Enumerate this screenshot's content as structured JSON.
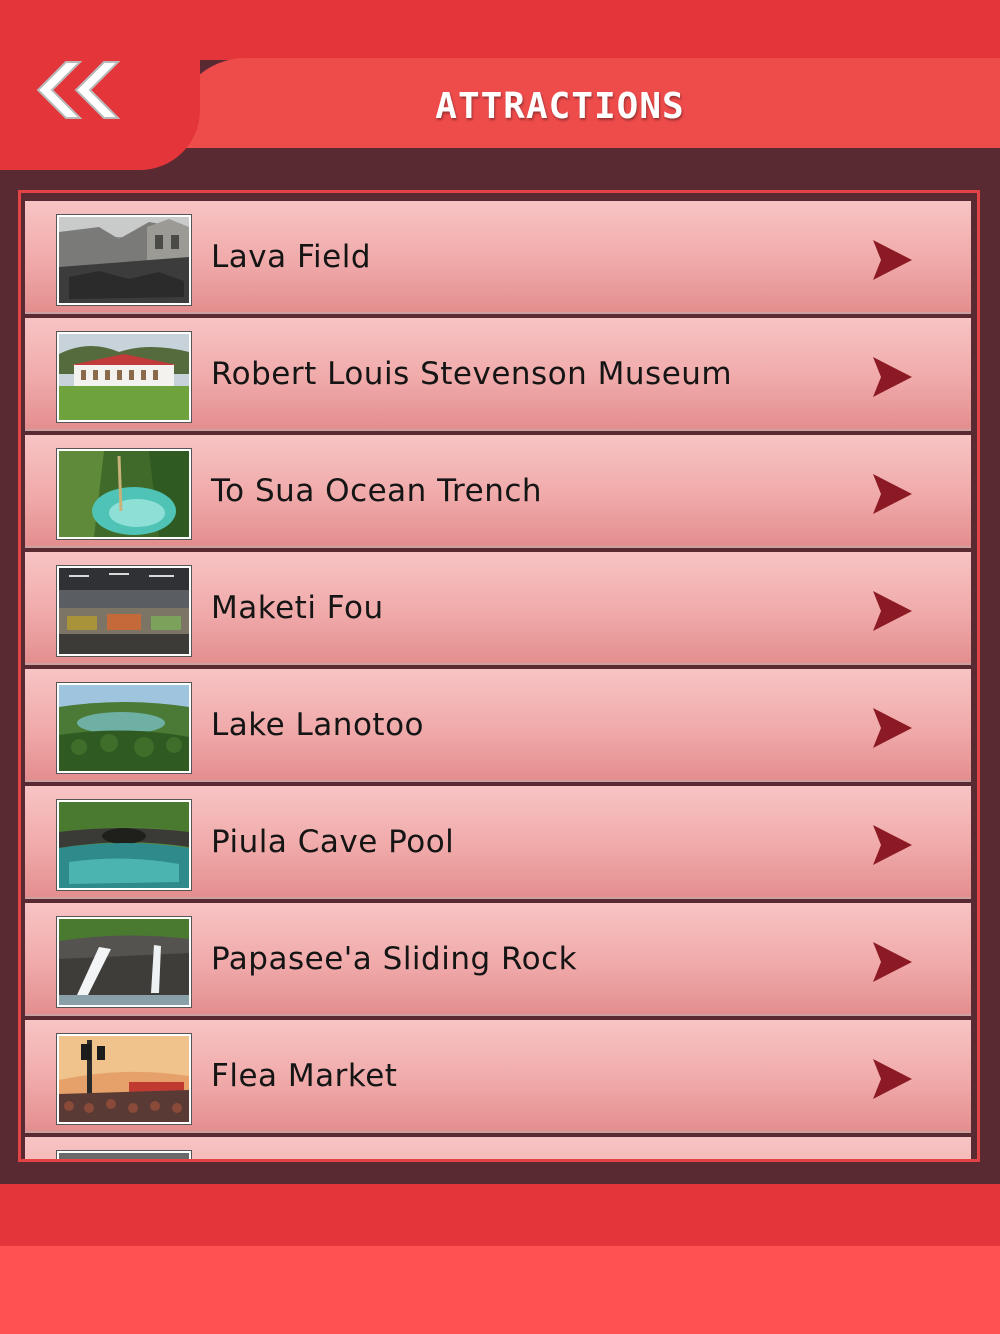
{
  "header": {
    "title": "ATTRACTIONS",
    "back_icon": "double-chevron-left-icon"
  },
  "colors": {
    "header_red": "#e4353a",
    "header_bar": "#ee4b4b",
    "background": "#5a2a33",
    "row_top": "#f8c4c4",
    "row_bottom": "#e38d8d",
    "chevron": "#8b1a24"
  },
  "attractions": [
    {
      "label": "Lava Field",
      "thumb": "ruined-stone-church-on-lava"
    },
    {
      "label": "Robert Louis Stevenson Museum",
      "thumb": "white-colonial-mansion-on-lawn"
    },
    {
      "label": "To Sua Ocean Trench",
      "thumb": "turquoise-pool-in-trench"
    },
    {
      "label": "Maketi Fou",
      "thumb": "indoor-market-stalls"
    },
    {
      "label": "Lake Lanotoo",
      "thumb": "crater-lake-in-forest"
    },
    {
      "label": "Piula Cave Pool",
      "thumb": "clear-cave-pool"
    },
    {
      "label": "Papasee'a Sliding Rock",
      "thumb": "waterfalls-over-rock"
    },
    {
      "label": "Flea Market",
      "thumb": "crowded-market-street"
    }
  ]
}
